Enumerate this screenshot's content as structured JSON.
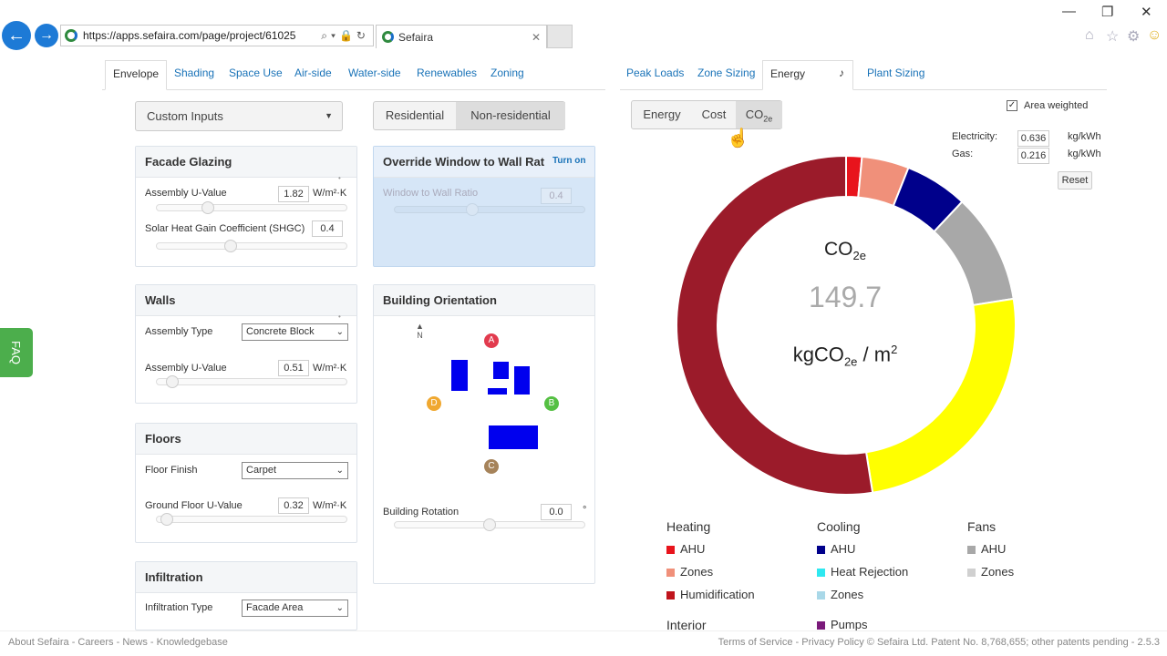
{
  "browser": {
    "url": "https://apps.sefaira.com/page/project/61025",
    "tab_title": "Sefaira",
    "tab_close": "✕",
    "win_min": "—",
    "win_restore": "❐",
    "win_close": "✕"
  },
  "left_tabs": [
    "Envelope",
    "Shading",
    "Space Use",
    "Air-side",
    "Water-side",
    "Renewables",
    "Zoning"
  ],
  "right_tabs": [
    "Peak Loads",
    "Zone Sizing",
    "Energy",
    "Plant Sizing"
  ],
  "inputs_select": "Custom Inputs",
  "type_toggle": [
    "Residential",
    "Non-residential"
  ],
  "facade_glazing": {
    "title": "Facade Glazing",
    "uvalue_label": "Assembly U-Value",
    "uvalue": "1.82",
    "uvalue_unit": "W/m²·K",
    "uvalue_level": 0.25,
    "shgc_label": "Solar Heat Gain Coefficient (SHGC)",
    "shgc": "0.4",
    "shgc_level": 0.38
  },
  "override_wwr": {
    "title": "Override Window to Wall Rat",
    "turn_on": "Turn on",
    "wwr_label": "Window to Wall Ratio",
    "wwr": "0.4",
    "wwr_level": 0.4
  },
  "walls": {
    "title": "Walls",
    "type_label": "Assembly Type",
    "type_value": "Concrete Block",
    "uvalue_label": "Assembly U-Value",
    "uvalue": "0.51",
    "uvalue_unit": "W/m²·K",
    "uvalue_level": 0.05
  },
  "orientation": {
    "title": "Building Orientation",
    "north": "N",
    "facades": [
      "A",
      "B",
      "C",
      "D"
    ],
    "rotation_label": "Building Rotation",
    "rotation": "0.0",
    "rotation_unit": "°",
    "rotation_level": 0.5
  },
  "floors": {
    "title": "Floors",
    "finish_label": "Floor Finish",
    "finish_value": "Carpet",
    "ground_label": "Ground Floor U-Value",
    "ground": "0.32",
    "ground_unit": "W/m²·K",
    "ground_level": 0.02
  },
  "infiltration": {
    "title": "Infiltration",
    "type_label": "Infiltration Type",
    "type_value": "Facade Area"
  },
  "metric_toggle": [
    "Energy",
    "Cost",
    "CO2e"
  ],
  "area_weighted": "Area weighted",
  "factors": {
    "electricity_label": "Electricity:",
    "electricity": "0.636",
    "gas_label": "Gas:",
    "gas": "0.216",
    "unit": "kg/kWh",
    "reset": "Reset"
  },
  "donut_center": {
    "metric": "CO2e",
    "value": "149.7",
    "unit": "kgCO2e / m2"
  },
  "chart_data": {
    "type": "pie",
    "title": "",
    "slices": [
      {
        "label": "Heating AHU",
        "value": 1.5,
        "color": "#e8141c"
      },
      {
        "label": "Heating Zones",
        "value": 4.5,
        "color": "#f0907a"
      },
      {
        "label": "Cooling AHU",
        "value": 6.0,
        "color": "#00008b"
      },
      {
        "label": "Fans AHU",
        "value": 10.5,
        "color": "#a8a8a8"
      },
      {
        "label": "Interior (lighting)",
        "value": 25.0,
        "color": "#ffff00"
      },
      {
        "label": "Humidification",
        "value": 52.5,
        "color": "#9b1b2a"
      }
    ]
  },
  "legend": {
    "heating": {
      "title": "Heating",
      "items": [
        {
          "label": "AHU",
          "color": "#e8141c"
        },
        {
          "label": "Zones",
          "color": "#f0907a"
        },
        {
          "label": "Humidification",
          "color": "#c0141c"
        }
      ]
    },
    "cooling": {
      "title": "Cooling",
      "items": [
        {
          "label": "AHU",
          "color": "#00008b"
        },
        {
          "label": "Heat Rejection",
          "color": "#2ee8f0"
        },
        {
          "label": "Zones",
          "color": "#a9d8e8"
        }
      ]
    },
    "fans": {
      "title": "Fans",
      "items": [
        {
          "label": "AHU",
          "color": "#a8a8a8"
        },
        {
          "label": "Zones",
          "color": "#d0d0d0"
        }
      ]
    },
    "interior": {
      "title": "Interior"
    },
    "pumps": {
      "label": "Pumps",
      "color": "#7a1a7a"
    }
  },
  "faq": "FAQ",
  "footer": {
    "left": "About Sefaira - Careers - News - Knowledgebase",
    "right": "Terms of Service - Privacy Policy © Sefaira Ltd. Patent No. 8,768,655; other patents pending - 2.5.3"
  }
}
